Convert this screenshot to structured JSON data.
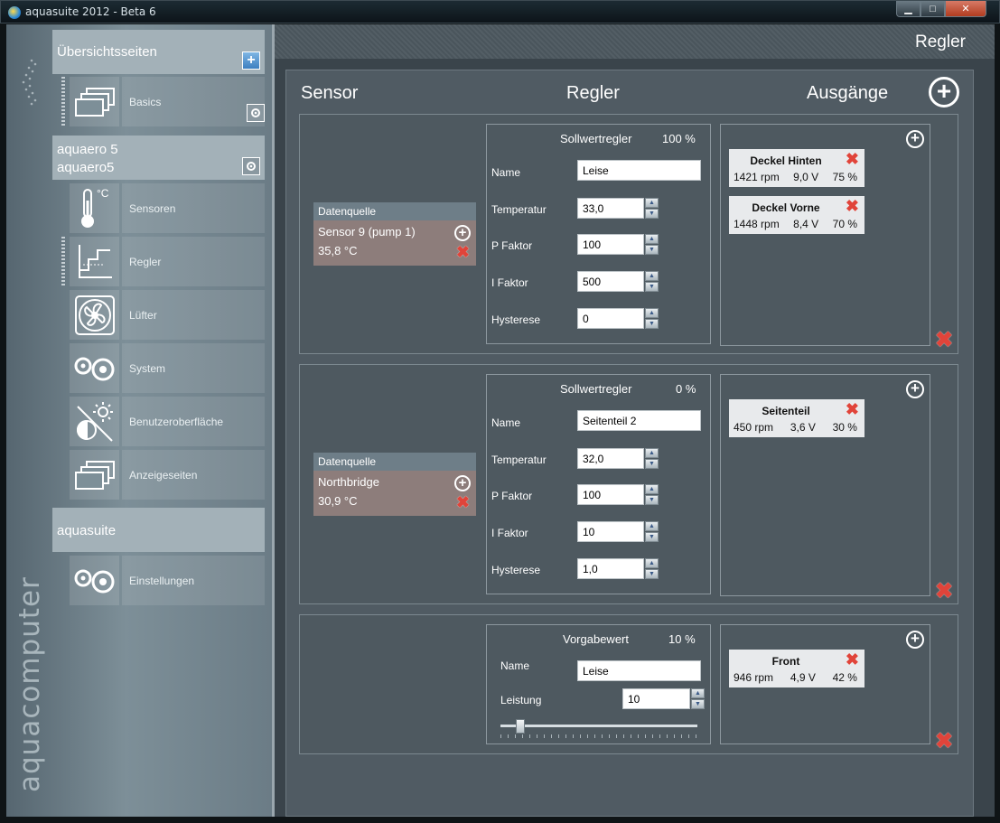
{
  "window": {
    "title": "aquasuite 2012 - Beta 6",
    "controls": {
      "minimize": "▁",
      "maximize": "□",
      "close": "✕"
    }
  },
  "sidebar": {
    "brand": "aquacomputer",
    "sections": [
      {
        "title": "Übersichtsseiten",
        "items": [
          {
            "label": "Basics",
            "icon": "pages-icon"
          }
        ]
      },
      {
        "title": "aquaero 5",
        "subtitle": "aquaero5",
        "items": [
          {
            "label": "Sensoren",
            "icon": "thermometer-icon",
            "icon_text": "°C"
          },
          {
            "label": "Regler",
            "icon": "controller-curve-icon"
          },
          {
            "label": "Lüfter",
            "icon": "fan-icon"
          },
          {
            "label": "System",
            "icon": "system-gears-icon"
          },
          {
            "label": "Benutzeroberfläche",
            "icon": "display-settings-icon"
          },
          {
            "label": "Anzeigeseiten",
            "icon": "pages-icon"
          }
        ]
      },
      {
        "title": "aquasuite",
        "items": [
          {
            "label": "Einstellungen",
            "icon": "settings-gears-icon"
          }
        ]
      }
    ]
  },
  "main": {
    "page_title": "Regler",
    "columns": {
      "sensor": "Sensor",
      "controller": "Regler",
      "outputs": "Ausgänge"
    },
    "controllers": [
      {
        "datasource": {
          "header": "Datenquelle",
          "sensor": "Sensor 9 (pump 1)",
          "value": "35,8 °C"
        },
        "type": "Sollwertregler",
        "percent": "100 %",
        "fields": [
          {
            "label": "Name",
            "value": "Leise"
          },
          {
            "label": "Temperatur",
            "value": "33,0"
          },
          {
            "label": "P Faktor",
            "value": "100"
          },
          {
            "label": "I Faktor",
            "value": "500"
          },
          {
            "label": "Hysterese",
            "value": "0"
          }
        ],
        "outputs": [
          {
            "name": "Deckel  Hinten",
            "rpm": "1421 rpm",
            "volt": "9,0 V",
            "pct": "75 %"
          },
          {
            "name": "Deckel Vorne",
            "rpm": "1448 rpm",
            "volt": "8,4 V",
            "pct": "70 %"
          }
        ]
      },
      {
        "datasource": {
          "header": "Datenquelle",
          "sensor": "Northbridge",
          "value": "30,9 °C"
        },
        "type": "Sollwertregler",
        "percent": "0 %",
        "fields": [
          {
            "label": "Name",
            "value": "Seitenteil 2"
          },
          {
            "label": "Temperatur",
            "value": "32,0"
          },
          {
            "label": "P Faktor",
            "value": "100"
          },
          {
            "label": "I Faktor",
            "value": "10"
          },
          {
            "label": "Hysterese",
            "value": "1,0"
          }
        ],
        "outputs": [
          {
            "name": "Seitenteil",
            "rpm": "450 rpm",
            "volt": "3,6 V",
            "pct": "30 %"
          }
        ]
      },
      {
        "type": "Vorgabewert",
        "percent": "10 %",
        "fields": [
          {
            "label": "Name",
            "value": "Leise"
          },
          {
            "label": "Leistung",
            "value": "10"
          }
        ],
        "slider_fraction": 0.1,
        "outputs": [
          {
            "name": "Front",
            "rpm": "946 rpm",
            "volt": "4,9 V",
            "pct": "42 %"
          }
        ]
      }
    ]
  },
  "colors": {
    "accent_red": "#e0443a",
    "datasource_bg": "#8d7d7b",
    "panel_bg": "#505b63"
  }
}
